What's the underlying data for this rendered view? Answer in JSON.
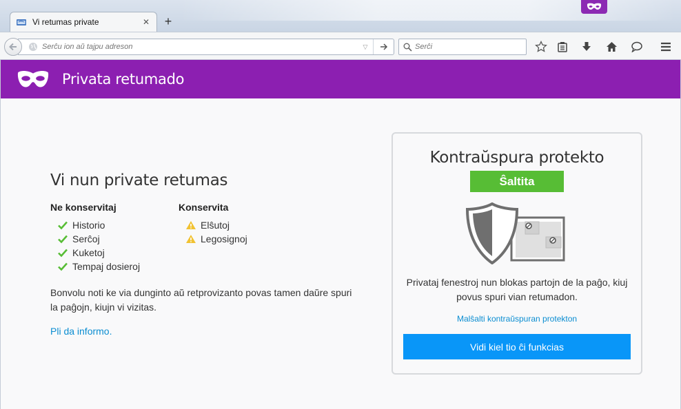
{
  "window": {
    "tab_title": "Vi retumas private",
    "tab_close": "✕",
    "new_tab": "+"
  },
  "navbar": {
    "url_placeholder": "Serĉu ion aŭ tajpu adreson",
    "search_placeholder": "Serĉi"
  },
  "banner": {
    "title": "Privata retumado"
  },
  "info": {
    "heading": "Vi nun private retumas",
    "not_saved_heading": "Ne konservitaj",
    "not_saved_items": [
      "Historio",
      "Serĉoj",
      "Kuketoj",
      "Tempaj dosieroj"
    ],
    "saved_heading": "Konservita",
    "saved_items": [
      "Elŝutoj",
      "Legosignoj"
    ],
    "note": "Bonvolu noti ke via dunginto aŭ retprovizanto povas tamen daŭre spuri la paĝojn, kiujn vi vizitas.",
    "learn_more": "Pli da informo."
  },
  "tracking": {
    "heading": "Kontraŭspura protekto",
    "status": "Ŝaltita",
    "description": "Privataj fenestroj nun blokas partojn de la paĝo, kiuj povus spuri vian retumadon.",
    "disable_link": "Malŝalti kontraŭspuran protekton",
    "tour_button": "Vidi kiel tio ĉi funkcias"
  },
  "colors": {
    "private_purple": "#8c1fb1",
    "status_green": "#57bd35",
    "link_blue": "#0a8dd1",
    "button_blue": "#0996f8"
  }
}
